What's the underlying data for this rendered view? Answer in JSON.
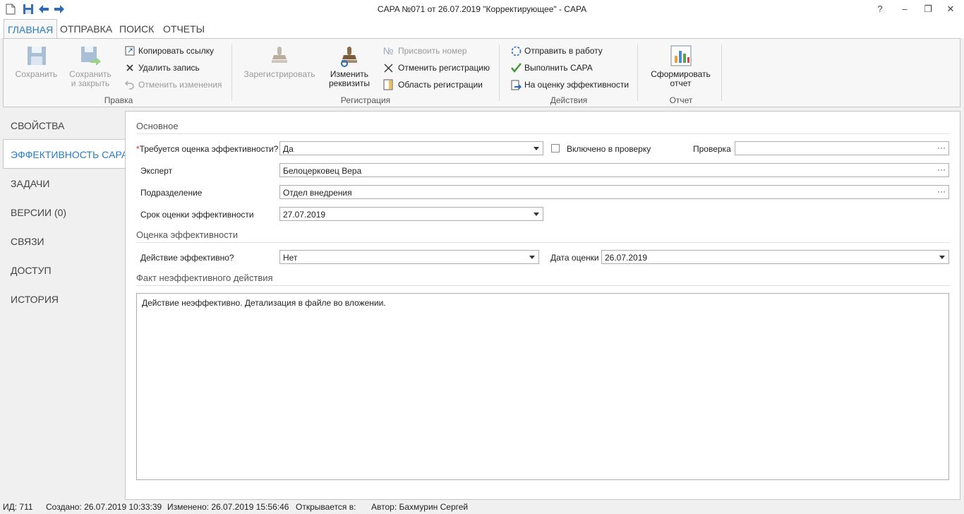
{
  "window": {
    "title": "CAPA №071 от 26.07.2019 \"Корректирующее\" - CAPA",
    "help": "?",
    "minimize": "‒",
    "restore": "❐",
    "close": "✕"
  },
  "tabs": [
    {
      "label": "ГЛАВНАЯ",
      "active": true
    },
    {
      "label": "ОТПРАВКА"
    },
    {
      "label": "ПОИСК"
    },
    {
      "label": "ОТЧЕТЫ"
    }
  ],
  "ribbon": {
    "pravka": {
      "group_label": "Правка",
      "save": "Сохранить",
      "save_close_1": "Сохранить",
      "save_close_2": "и закрыть",
      "copy_link": "Копировать ссылку",
      "delete": "Удалить запись",
      "undo": "Отменить изменения"
    },
    "registration": {
      "group_label": "Регистрация",
      "register": "Зарегистрировать",
      "change_1": "Изменить",
      "change_2": "реквизиты",
      "assign_number": "Присвоить номер",
      "cancel_reg": "Отменить регистрацию",
      "reg_area": "Область регистрации"
    },
    "actions": {
      "group_label": "Действия",
      "send_to_work": "Отправить в работу",
      "do_capa": "Выполнить CAPA",
      "to_eval": "На оценку эффективности"
    },
    "report": {
      "group_label": "Отчет",
      "make_1": "Сформировать",
      "make_2": "отчет"
    }
  },
  "nav": [
    {
      "label": "СВОЙСТВА"
    },
    {
      "label": "ЭФФЕКТИВНОСТЬ CAPA",
      "active": true
    },
    {
      "label": "ЗАДАЧИ"
    },
    {
      "label": "ВЕРСИИ (0)"
    },
    {
      "label": "СВЯЗИ"
    },
    {
      "label": "ДОСТУП"
    },
    {
      "label": "ИСТОРИЯ"
    }
  ],
  "form": {
    "section_main": "Основное",
    "req_mark": "*",
    "eval_required_label": "Требуется оценка эффективности?",
    "eval_required_value": "Да",
    "included_label": "Включено в проверку",
    "check_label": "Проверка",
    "check_value": "",
    "expert_label": "Эксперт",
    "expert_value": "Белоцерковец Вера",
    "dept_label": "Подразделение",
    "dept_value": "Отдел внедрения",
    "deadline_label": "Срок оценки эффективности",
    "deadline_value": "27.07.2019",
    "section_eval": "Оценка эффективности",
    "effective_label": "Действие эффективно?",
    "effective_value": "Нет",
    "eval_date_label": "Дата оценки",
    "eval_date_value": "26.07.2019",
    "section_fact": "Факт неэффективного действия",
    "fact_text": "Действие неэффективно. Детализация в файле во вложении.",
    "dots": "···"
  },
  "statusbar": {
    "id": "ИД: 711",
    "created": "Создано: 26.07.2019 10:33:39",
    "modified": "Изменено: 26.07.2019 15:56:46",
    "opens": "Открывается в:",
    "author": "Автор: Бахмурин Сергей"
  }
}
